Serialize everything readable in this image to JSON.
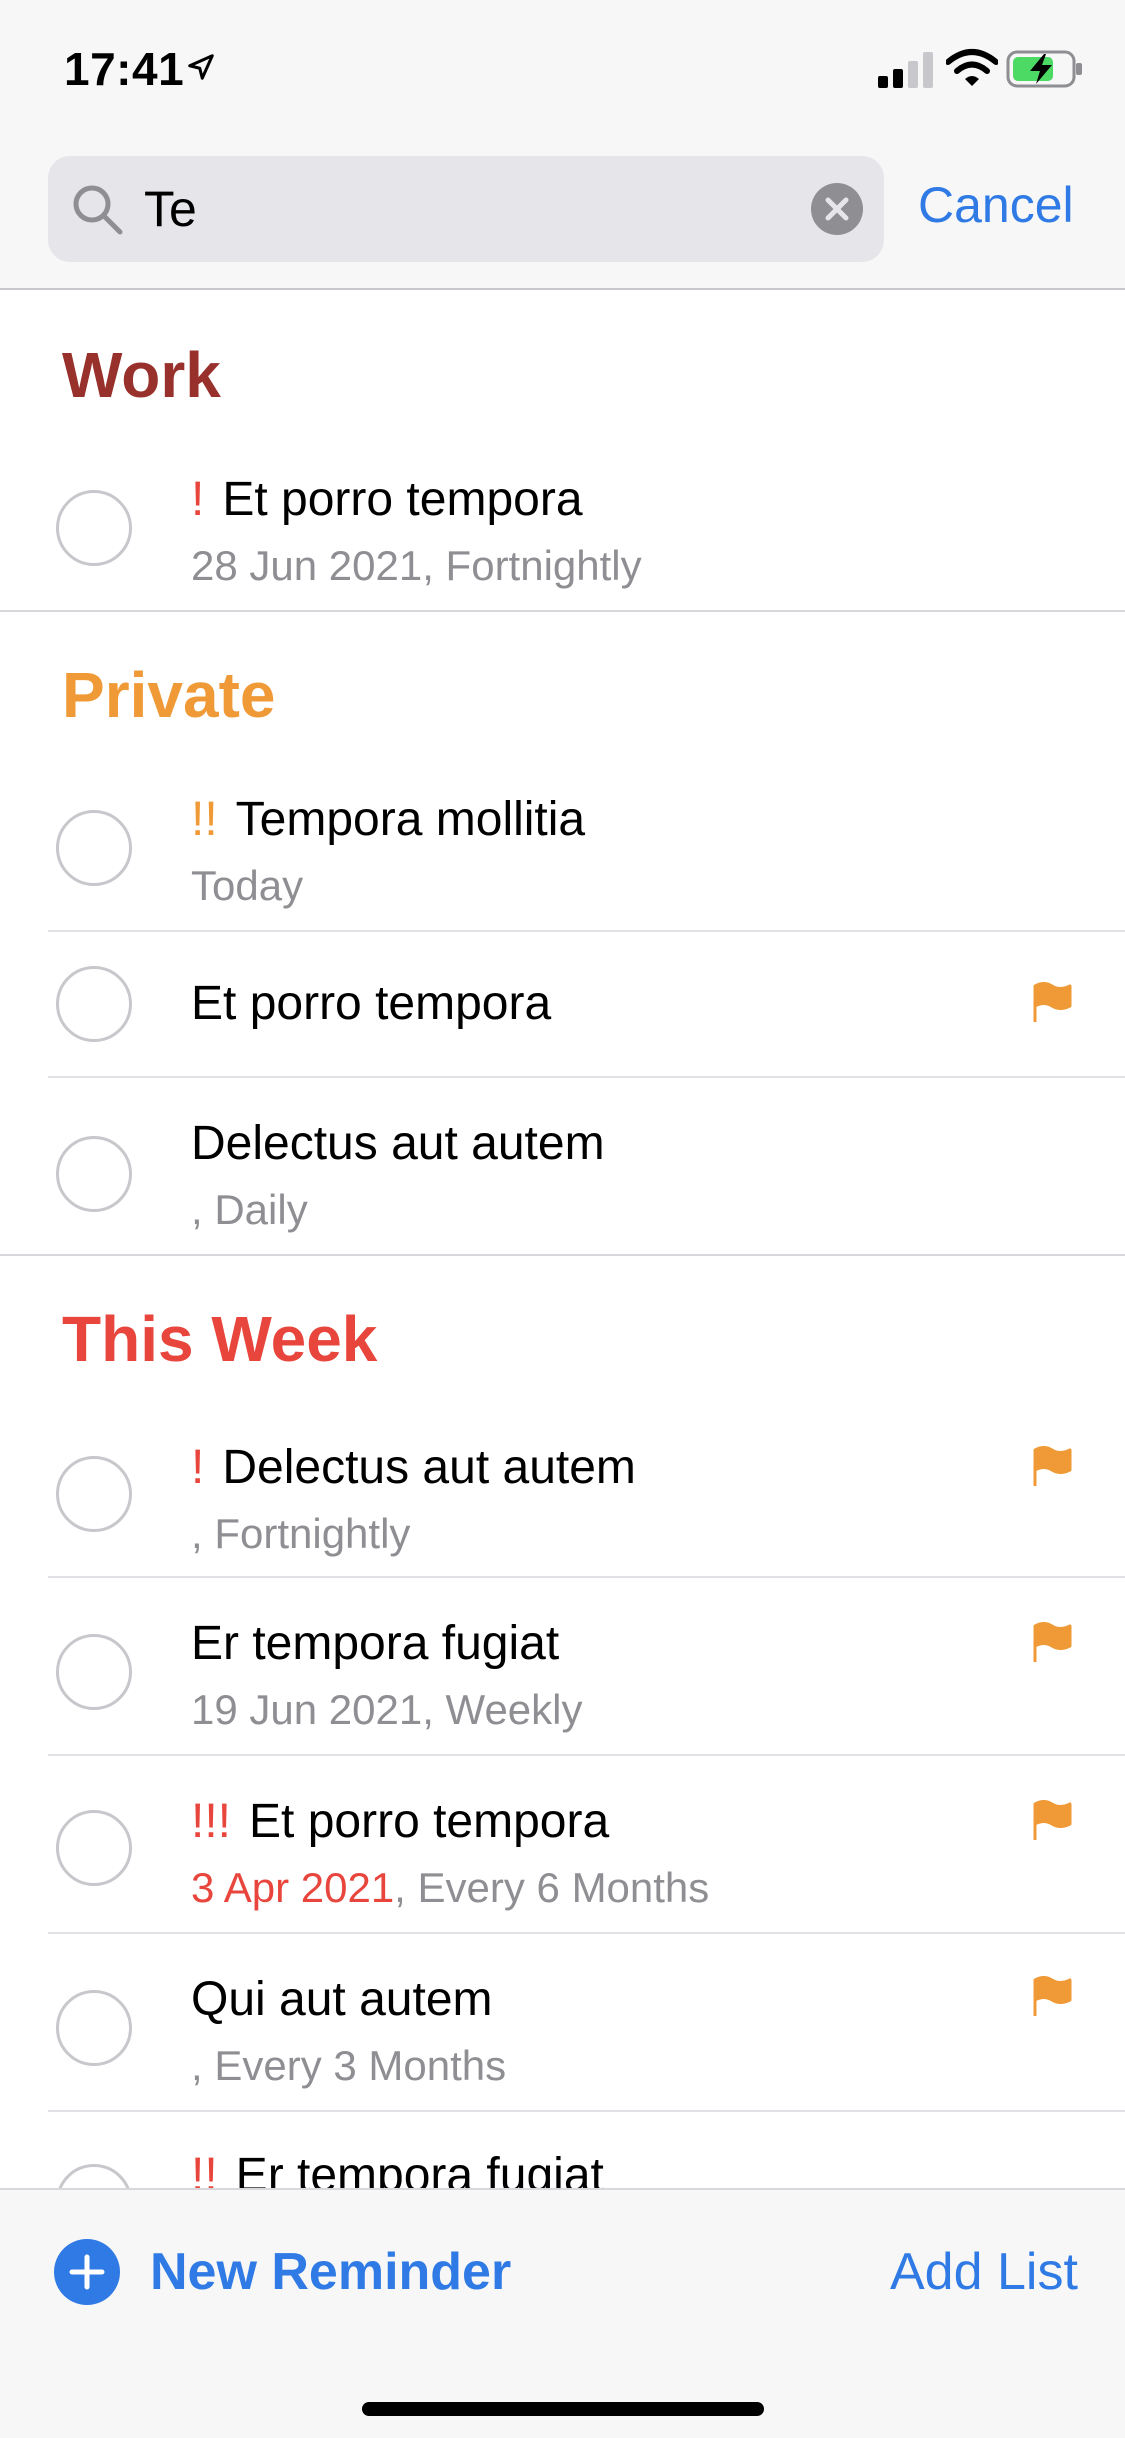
{
  "status": {
    "time": "17:41"
  },
  "search": {
    "query": "Te",
    "cancel_label": "Cancel"
  },
  "colors": {
    "accent": "#2f7ae5",
    "work": "#98302c",
    "private": "#f09a37",
    "this_week": "#e8453c",
    "overdue": "#e8453c",
    "flag": "#f09a37"
  },
  "sections": [
    {
      "title": "Work",
      "items": [
        {
          "priority": "!",
          "title": "Et porro tempora",
          "date": "28 Jun 2021",
          "repeat": ", Fortnightly",
          "flagged": false
        }
      ]
    },
    {
      "title": "Private",
      "items": [
        {
          "priority": "!!",
          "title": "Tempora mollitia",
          "date": "Today",
          "repeat": "",
          "flagged": false
        },
        {
          "priority": "",
          "title": "Et porro tempora",
          "date": "",
          "repeat": "",
          "flagged": true
        },
        {
          "priority": "",
          "title": "Delectus aut autem",
          "date": "",
          "repeat": ", Daily",
          "flagged": false
        }
      ]
    },
    {
      "title": "This Week",
      "items": [
        {
          "priority": "!",
          "title": "Delectus aut autem",
          "date": "",
          "repeat": ", Fortnightly",
          "flagged": true
        },
        {
          "priority": "",
          "title": "Er tempora fugiat",
          "date": "19 Jun 2021",
          "repeat": ", Weekly",
          "flagged": true
        },
        {
          "priority": "!!!",
          "title": "Et porro tempora",
          "date": "3 Apr 2021",
          "repeat": ", Every 6 Months",
          "flagged": true,
          "overdue": true
        },
        {
          "priority": "",
          "title": "Qui aut autem",
          "date": "",
          "repeat": ", Every 3 Months",
          "flagged": true
        },
        {
          "priority": "!!",
          "title": "Er tempora fugiat",
          "date": "",
          "repeat": "",
          "flagged": false
        }
      ]
    }
  ],
  "bottom": {
    "new_reminder_label": "New Reminder",
    "add_list_label": "Add List"
  }
}
